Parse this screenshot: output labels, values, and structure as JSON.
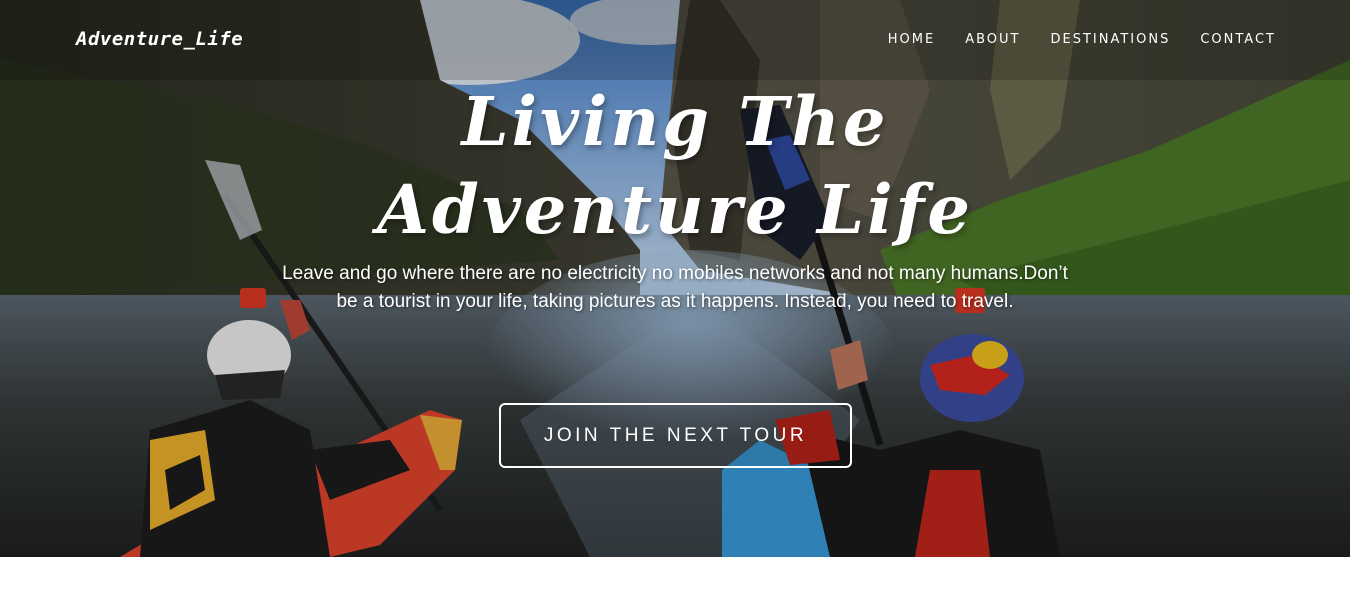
{
  "brand": {
    "logo": "Adventure_Life"
  },
  "nav": {
    "items": [
      "HOME",
      "ABOUT",
      "DESTINATIONS",
      "CONTACT"
    ]
  },
  "hero": {
    "title_line1": "Living The",
    "title_line2": "Adventure Life",
    "subtitle": "Leave and go where there are no electricity no mobiles networks and not many humans.Don’t be a tourist in your life, taking pictures as it happens. Instead, you need to travel.",
    "cta": "JOIN THE NEXT TOUR"
  }
}
